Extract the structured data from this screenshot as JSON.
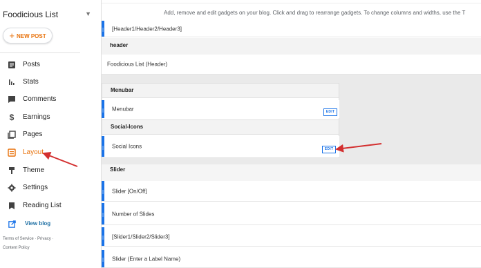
{
  "sidebar": {
    "blog_name": "Foodicious List",
    "new_post_label": "NEW POST",
    "nav": [
      {
        "label": "Posts",
        "icon": "posts-icon"
      },
      {
        "label": "Stats",
        "icon": "stats-icon"
      },
      {
        "label": "Comments",
        "icon": "comments-icon"
      },
      {
        "label": "Earnings",
        "icon": "earnings-icon"
      },
      {
        "label": "Pages",
        "icon": "pages-icon"
      },
      {
        "label": "Layout",
        "icon": "layout-icon",
        "active": true
      },
      {
        "label": "Theme",
        "icon": "theme-icon"
      },
      {
        "label": "Settings",
        "icon": "settings-icon"
      },
      {
        "label": "Reading List",
        "icon": "reading-list-icon"
      }
    ],
    "view_blog_label": "View blog",
    "footer": {
      "terms": "Terms of Service",
      "privacy": "Privacy",
      "content_policy": "Content Policy"
    }
  },
  "main": {
    "hint": "Add, remove and edit gadgets on your blog. Click and drag to rearrange gadgets. To change columns and widths, use the T",
    "gadget_top": "[Header1/Header2/Header3]",
    "header_section": {
      "title": "header",
      "gadget": "Foodicious List (Header)"
    },
    "menubar_section": {
      "title": "Menubar",
      "gadget": "Menubar",
      "edit_label": "EDIT"
    },
    "social_section": {
      "title": "Social-Icons",
      "gadget": "Social Icons",
      "edit_label": "EDIT"
    },
    "slider_section": {
      "title": "Slider",
      "gadgets": [
        "Slider [On/Off]",
        "Number of Slides",
        "[Slider1/Slider2/Slider3]",
        "Slider (Enter a Label Name)"
      ]
    }
  },
  "colors": {
    "accent_orange": "#e8710a",
    "handle_blue": "#1a73e8",
    "annotation_red": "#d32f2f"
  }
}
